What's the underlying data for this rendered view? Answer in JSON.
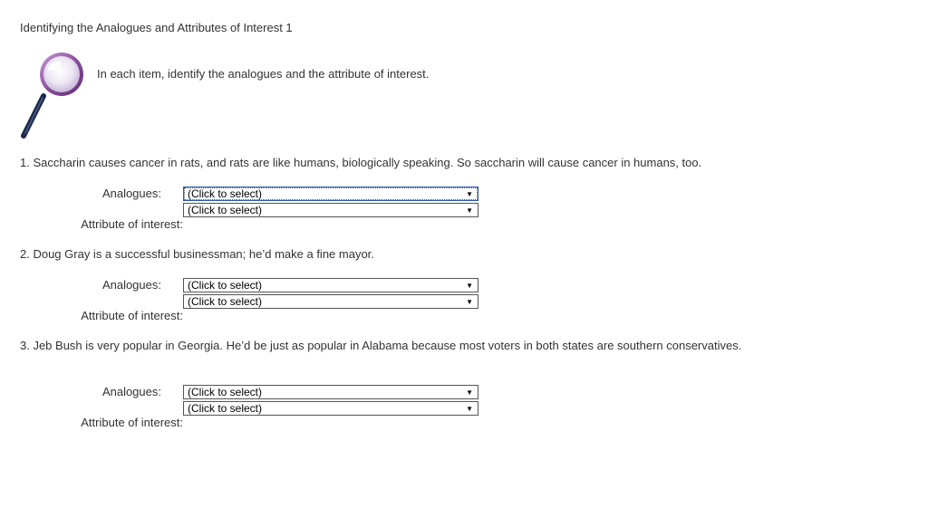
{
  "page": {
    "title": "Identifying the Analogues and Attributes of Interest 1",
    "instructions": "In each item, identify the analogues and the attribute of interest."
  },
  "labels": {
    "analogues": "Analogues:",
    "attribute": "Attribute of interest:"
  },
  "select_placeholder": "(Click to select)",
  "icons": {
    "magnifier": "magnifying-glass-icon",
    "dropdown": "triangle-down"
  },
  "questions": [
    {
      "text": "1. Saccharin causes cancer in rats, and rats are like humans, biologically speaking. So saccharin will cause cancer in humans, too.",
      "analogues_value": "(Click to select)",
      "attribute_value": "(Click to select)"
    },
    {
      "text": "2. Doug Gray is a successful businessman; he’d make a fine mayor.",
      "analogues_value": "(Click to select)",
      "attribute_value": "(Click to select)"
    },
    {
      "text": "3. Jeb Bush is very popular in Georgia. He’d be just as popular in Alabama because most voters in both states are southern conservatives.",
      "analogues_value": "(Click to select)",
      "attribute_value": "(Click to select)"
    }
  ],
  "colors": {
    "text": "#333333",
    "focus_border": "#2a5bb7",
    "magnifier_handle": "#1f2a4a",
    "magnifier_rim": "#8a4f9e"
  }
}
